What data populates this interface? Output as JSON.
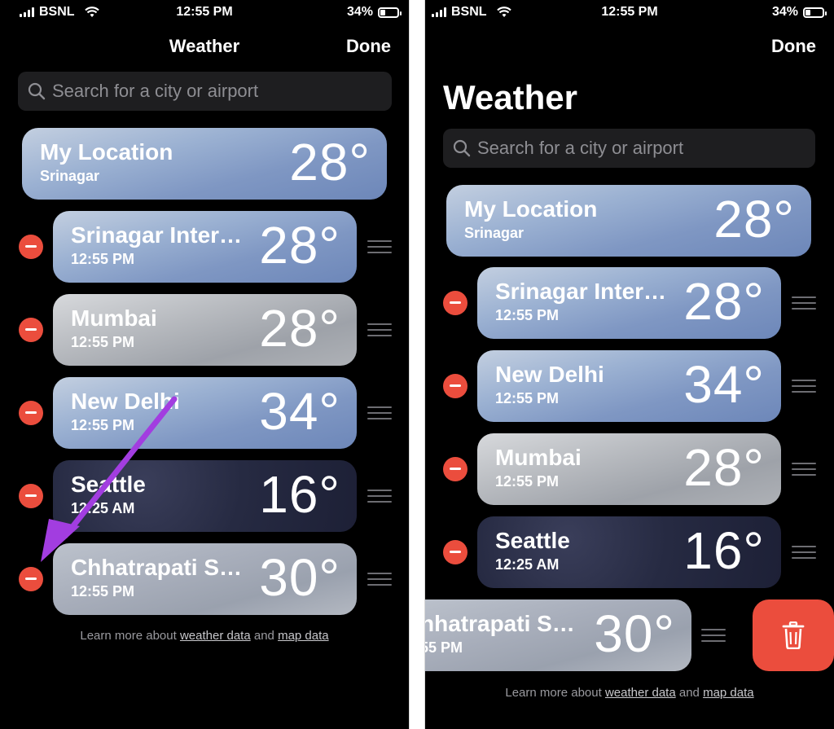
{
  "left": {
    "status": {
      "carrier": "BSNL",
      "time": "12:55 PM",
      "battery": "34%"
    },
    "header": {
      "title": "Weather",
      "done_label": "Done"
    },
    "search": {
      "placeholder": "Search for a city or airport"
    },
    "my_location": {
      "title": "My Location",
      "subtitle": "Srinagar",
      "temp": "28°"
    },
    "cities": [
      {
        "name": "Srinagar Inter…",
        "time": "12:55 PM",
        "temp": "28°"
      },
      {
        "name": "Mumbai",
        "time": "12:55 PM",
        "temp": "28°"
      },
      {
        "name": "New Delhi",
        "time": "12:55 PM",
        "temp": "34°"
      },
      {
        "name": "Seattle",
        "time": "12:25 AM",
        "temp": "16°"
      },
      {
        "name": "Chhatrapati S…",
        "time": "12:55 PM",
        "temp": "30°"
      }
    ],
    "footer": {
      "prefix": "Learn more about",
      "link1": "weather data",
      "middle": "and",
      "link2": "map data"
    }
  },
  "right": {
    "status": {
      "carrier": "BSNL",
      "time": "12:55 PM",
      "battery": "34%"
    },
    "header": {
      "title": "Weather",
      "done_label": "Done"
    },
    "search": {
      "placeholder": "Search for a city or airport"
    },
    "my_location": {
      "title": "My Location",
      "subtitle": "Srinagar",
      "temp": "28°"
    },
    "cities": [
      {
        "name": "Srinagar Inter…",
        "time": "12:55 PM",
        "temp": "28°"
      },
      {
        "name": "New Delhi",
        "time": "12:55 PM",
        "temp": "34°"
      },
      {
        "name": "Mumbai",
        "time": "12:55 PM",
        "temp": "28°"
      },
      {
        "name": "Seattle",
        "time": "12:25 AM",
        "temp": "16°"
      }
    ],
    "swiped_row": {
      "name": "hhatrapati S…",
      "time": "55 PM",
      "temp": "30°"
    },
    "footer": {
      "prefix": "Learn more about",
      "link1": "weather data",
      "middle": "and",
      "link2": "map data"
    }
  },
  "colors": {
    "delete_red": "#eb4d3d",
    "annotation_arrow": "#a23de0",
    "search_bg": "#1e1e20"
  },
  "icons": [
    "search-icon",
    "wifi-icon",
    "battery-icon",
    "minus-circle-icon",
    "reorder-grip-icon",
    "trash-icon",
    "annotation-arrow"
  ]
}
